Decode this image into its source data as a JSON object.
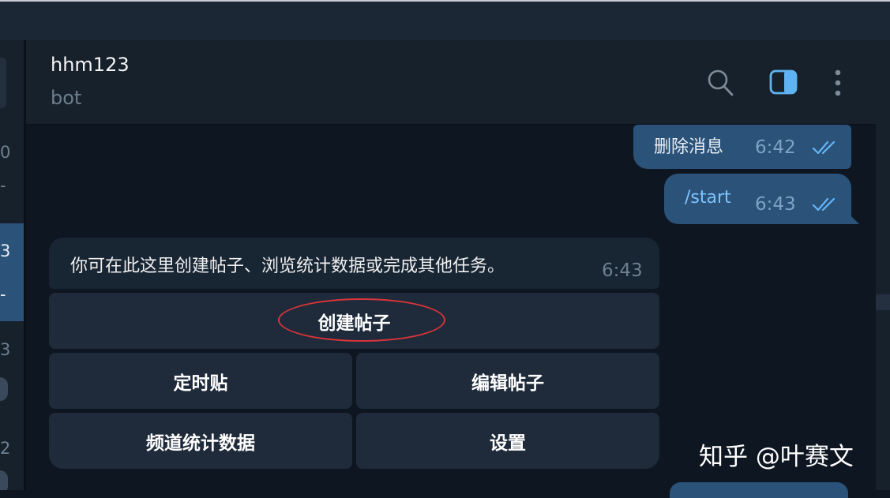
{
  "chat": {
    "title": "hhm123",
    "subtitle": "bot"
  },
  "header_icons": [
    "search-icon",
    "sidebar-toggle-icon",
    "more-vertical-icon"
  ],
  "left_panel": {
    "fragments": [
      "0",
      "-",
      "3",
      "-",
      "3",
      "2"
    ]
  },
  "messages": [
    {
      "direction": "outgoing",
      "text": "删除消息",
      "time": "6:42",
      "status": "read"
    },
    {
      "direction": "outgoing",
      "text": "/start",
      "time": "6:43",
      "status": "read",
      "is_command": true
    },
    {
      "direction": "incoming",
      "text": "你可在此这里创建帖子、浏览统计数据或完成其他任务。",
      "time": "6:43"
    }
  ],
  "inline_keyboard": {
    "rows": [
      [
        "创建帖子"
      ],
      [
        "定时贴",
        "编辑帖子"
      ],
      [
        "频道统计数据",
        "设置"
      ]
    ]
  },
  "annotation": {
    "highlight_target": "创建帖子",
    "color": "#d9343a"
  },
  "watermark": "知乎 @叶赛文",
  "colors": {
    "background": "#0e1621",
    "outgoing_bubble": "#2b5278",
    "incoming_bubble": "#182533",
    "keyboard_button": "#1f2b3a",
    "accent": "#64b5f6"
  }
}
